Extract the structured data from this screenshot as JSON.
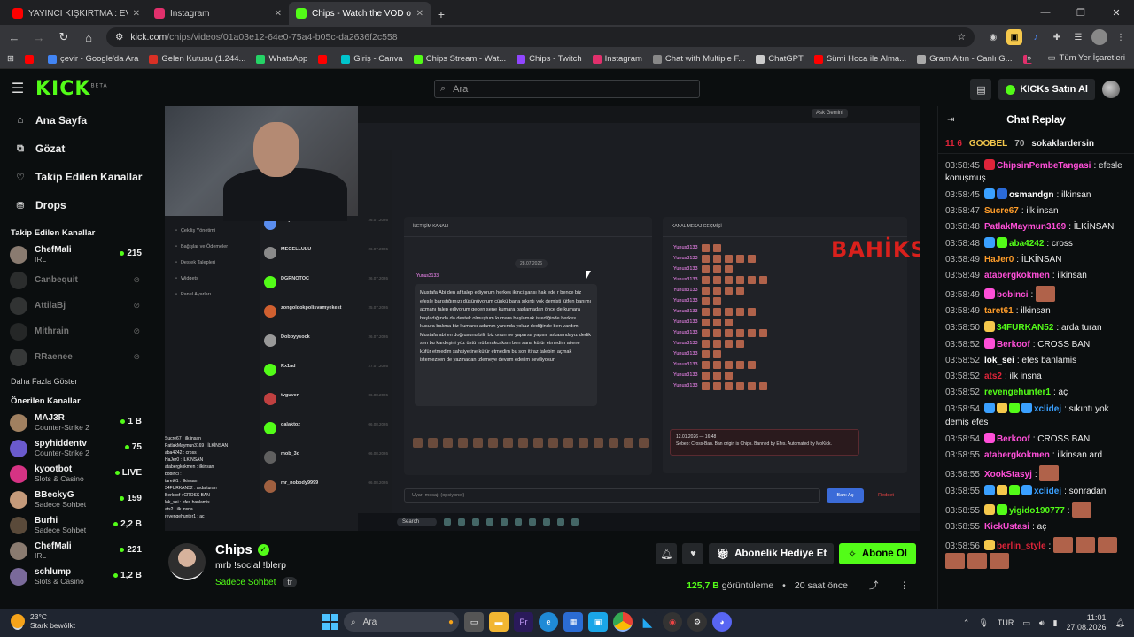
{
  "browser": {
    "tabs": [
      {
        "title": "YAYINCI KIŞKIRTMA : EVE DÖN",
        "color": "#ff0000"
      },
      {
        "title": "Instagram",
        "color": "#e1306c"
      },
      {
        "title": "Chips - Watch the VOD on",
        "color": "#53fc18"
      }
    ],
    "url_host": "kick.com",
    "url_path": "/chips/videos/01a03e12-64e0-75a4-b05c-da2636f2c558",
    "bookmarks": [
      {
        "label": "",
        "color": "#ff0000"
      },
      {
        "label": "çevir - Google'da Ara",
        "color": "#4285f4"
      },
      {
        "label": "Gelen Kutusu (1.244...",
        "color": "#d93025"
      },
      {
        "label": "WhatsApp",
        "color": "#25d366"
      },
      {
        "label": "",
        "color": "#ff0000"
      },
      {
        "label": "Giriş - Canva",
        "color": "#00c4cc"
      },
      {
        "label": "Chips Stream - Wat...",
        "color": "#53fc18"
      },
      {
        "label": "Chips - Twitch",
        "color": "#9146ff"
      },
      {
        "label": "Instagram",
        "color": "#e1306c"
      },
      {
        "label": "Chat with Multiple F...",
        "color": "#888888"
      },
      {
        "label": "ChatGPT",
        "color": "#cccccc"
      },
      {
        "label": "Sümi Hoca ile Alma...",
        "color": "#ff0000"
      },
      {
        "label": "Gram Altın - Canlı G...",
        "color": "#aaaaaa"
      },
      {
        "label": "almancanotlar",
        "color": "#e1306c"
      }
    ],
    "all_bookmarks": "Tüm Yer İşaretleri"
  },
  "header": {
    "logo": "KICK",
    "logo_beta": "BETA",
    "search_placeholder": "Ara",
    "buy_kicks": "KICKs Satın Al"
  },
  "sidebar": {
    "nav": [
      {
        "label": "Ana Sayfa",
        "icon": "home-icon",
        "glyph": "⌂"
      },
      {
        "label": "Gözat",
        "icon": "browse-icon",
        "glyph": "⧉"
      },
      {
        "label": "Takip Edilen Kanallar",
        "icon": "heart-icon",
        "glyph": "♡"
      },
      {
        "label": "Drops",
        "icon": "drops-icon",
        "glyph": "⛃"
      }
    ],
    "followed_title": "Takip Edilen Kanallar",
    "followed": [
      {
        "name": "ChefMali",
        "category": "IRL",
        "viewers": "215",
        "online": true,
        "color": "#8a7b70"
      },
      {
        "name": "Canbequit",
        "category": "",
        "viewers": "",
        "online": false,
        "color": "#666666"
      },
      {
        "name": "AttilaBj",
        "category": "",
        "viewers": "",
        "online": false,
        "color": "#777777"
      },
      {
        "name": "Mithrain",
        "category": "",
        "viewers": "",
        "online": false,
        "color": "#555555"
      },
      {
        "name": "RRaenee",
        "category": "",
        "viewers": "",
        "online": false,
        "color": "#888888"
      }
    ],
    "show_more": "Daha Fazla Göster",
    "recommended_title": "Önerilen Kanallar",
    "recommended": [
      {
        "name": "MAJ3R",
        "category": "Counter-Strike 2",
        "viewers": "1 B",
        "color": "#a08060"
      },
      {
        "name": "spyhiddentv",
        "category": "Counter-Strike 2",
        "viewers": "75",
        "color": "#6a5acd"
      },
      {
        "name": "kyootbot",
        "category": "Slots & Casino",
        "viewers": "LIVE",
        "color": "#d63384"
      },
      {
        "name": "BBeckyG",
        "category": "Sadece Sohbet",
        "viewers": "159",
        "color": "#c49a7a"
      },
      {
        "name": "Burhi",
        "category": "Sadece Sohbet",
        "viewers": "2,2 B",
        "color": "#5a4a3a"
      },
      {
        "name": "ChefMali",
        "category": "IRL",
        "viewers": "221",
        "color": "#8a7b70"
      },
      {
        "name": "schlump",
        "category": "Slots & Casino",
        "viewers": "1,2 B",
        "color": "#7a6a9a"
      }
    ]
  },
  "video": {
    "ask_gemini": "Ask Gemini",
    "left_panel": [
      "Çekiliş Yönetimi",
      "Bağışlar ve Ödemeler",
      "Destek Talepleri",
      "Widgets",
      "Panel Ayarları"
    ],
    "dm_users": [
      {
        "name": "erayusto",
        "date": "26.07.2026",
        "color": "#5a8dee"
      },
      {
        "name": "MEGELLULU",
        "date": "26.07.2026",
        "color": "#8a8a8a"
      },
      {
        "name": "DGRNOTOC",
        "date": "26.07.2026",
        "color": "#53fc18"
      },
      {
        "name": "zongoldokpolisvamyekest",
        "date": "25.07.2026",
        "color": "#d06030"
      },
      {
        "name": "Dobbyysock",
        "date": "26.07.2026",
        "color": "#999999"
      },
      {
        "name": "Rx1ad",
        "date": "27.07.2026",
        "color": "#53fc18"
      },
      {
        "name": "tvguven",
        "date": "06.08.2026",
        "color": "#c04040"
      },
      {
        "name": "galaktoz",
        "date": "06.08.2026",
        "color": "#53fc18"
      },
      {
        "name": "mob_3d",
        "date": "06.08.2026",
        "color": "#606060"
      },
      {
        "name": "mr_nobody9999",
        "date": "06.08.2026",
        "color": "#a06040"
      }
    ],
    "overlay_chat": [
      "Sucre67 : ilk insan",
      "PatlakMaymun3169 : İLKİNSAN",
      "aba4242 : cross",
      "HaJer0 : İLKİNSAN",
      "atabergkokmen : ilkinsan",
      "bobinci :",
      "taret61 : ilkinsan",
      "34FURKAN52 : arda turan",
      "Berkoof : CROSS BAN",
      "lok_sei : efes banlamis",
      "ats2 : ilk insna",
      "revengehunter1 : aç"
    ],
    "conversation_header": "İLETİŞİM KANALI",
    "conv_date": "28.07.2026",
    "dm_user": "Yunus3133",
    "message": "Mustafa Abi den af talep ediyorum herkes ikinci şansı hak ede r bence biz efesle barıştığımızı düşünüyorum çünkü bana sıkıntı yok demişti lütfen banımı açmanı talep ediyorum geçen sene kumara başlamadan önce de kumara başladığında da destek olmuştum kumara başlamak istediğinde herkes kusura bakma biz kumarcı adamın yanında yokuz dediğinde ben vardım Mustafa abi en doğrusunu bilir biz onun ne yaparsa yapsın arkasındayız dedik sen bu kardeşini yüz üstü mü bırakcaksın ben sana küfür etmedim ailene küfür etmedim şahsiyetine küfür etmedim bu son itiraz talebim açmak istemezsen de yazmadan izlemeye devam ederim seviliyosun",
    "history_header": "KANAL MESAJ GEÇMİŞİ",
    "history_user": "Yunus3133",
    "bahiks": "BAHİKS",
    "ban_text": "Sebep: Cross-Ban. Ban origin is Chips. Banned by Efes. Automated by MoKick.",
    "ban_date": "12.01.2026 — 16:48",
    "reason_placeholder": "Uyarı mesajı (opsiyonel)",
    "ban_button": "Banı Aç",
    "reject_button": "Reddet",
    "inner_search": "Search"
  },
  "stream": {
    "name": "Chips",
    "title": "mrb !social !blerp",
    "category": "Sadece Sohbet",
    "language": "tr",
    "gift_sub": "Abonelik Hediye Et",
    "subscribe": "Abone Ol",
    "views_value": "125,7 B",
    "views_label": "görüntüleme",
    "time_ago": "20 saat önce"
  },
  "chat": {
    "title": "Chat Replay",
    "pinned": [
      {
        "text": "11 6",
        "color": "#e0243a"
      },
      {
        "text": "GOOBEL",
        "color": "#f5c84c"
      },
      {
        "text": "70",
        "color": "#aaaaaa"
      },
      {
        "text": "sokaklardersin",
        "color": "#eeeeee"
      }
    ],
    "messages": [
      {
        "time": "03:58:45",
        "user": "ChipsinPembeTangasi",
        "color": "#ff4fd8",
        "badges": [
          "#e0243a"
        ],
        "text": "efesle konuşmuş",
        "emotes": 0
      },
      {
        "time": "03:58:45",
        "user": "osmandgn",
        "color": "#ffffff",
        "badges": [
          "#3aa0ff",
          "#2a6ad8"
        ],
        "text": "ilkinsan",
        "emotes": 0
      },
      {
        "time": "03:58:47",
        "user": "Sucre67",
        "color": "#ff9d2a",
        "badges": [],
        "text": "ilk insan",
        "emotes": 0
      },
      {
        "time": "03:58:48",
        "user": "PatlakMaymun3169",
        "color": "#ff4fd8",
        "badges": [],
        "text": "İLKİNSAN",
        "emotes": 0
      },
      {
        "time": "03:58:48",
        "user": "aba4242",
        "color": "#53fc18",
        "badges": [
          "#3aa0ff",
          "#53fc18"
        ],
        "text": "cross",
        "emotes": 0
      },
      {
        "time": "03:58:49",
        "user": "HaJer0",
        "color": "#ff9d2a",
        "badges": [],
        "text": "İLKİNSAN",
        "emotes": 0
      },
      {
        "time": "03:58:49",
        "user": "atabergkokmen",
        "color": "#ff4fd8",
        "badges": [],
        "text": "ilkinsan",
        "emotes": 0
      },
      {
        "time": "03:58:49",
        "user": "bobinci",
        "color": "#ff4fd8",
        "badges": [
          "#ff4fd8"
        ],
        "text": "",
        "emotes": 1
      },
      {
        "time": "03:58:49",
        "user": "taret61",
        "color": "#ff9d2a",
        "badges": [],
        "text": "ilkinsan",
        "emotes": 0
      },
      {
        "time": "03:58:50",
        "user": "34FURKAN52",
        "color": "#53fc18",
        "badges": [
          "#f5c84c"
        ],
        "text": "arda turan",
        "emotes": 0
      },
      {
        "time": "03:58:52",
        "user": "Berkoof",
        "color": "#ff4fd8",
        "badges": [
          "#ff4fd8"
        ],
        "text": "CROSS BAN",
        "emotes": 0
      },
      {
        "time": "03:58:52",
        "user": "lok_sei",
        "color": "#ffffff",
        "badges": [],
        "text": "efes banlamis",
        "emotes": 0
      },
      {
        "time": "03:58:52",
        "user": "ats2",
        "color": "#e0243a",
        "badges": [],
        "text": "ilk insna",
        "emotes": 0
      },
      {
        "time": "03:58:52",
        "user": "revengehunter1",
        "color": "#53fc18",
        "badges": [],
        "text": "aç",
        "emotes": 0
      },
      {
        "time": "03:58:54",
        "user": "xclidej",
        "color": "#3aa0ff",
        "badges": [
          "#3aa0ff",
          "#f5c84c",
          "#53fc18",
          "#3aa0ff"
        ],
        "text": "sıkıntı yok demiş efes",
        "emotes": 0
      },
      {
        "time": "03:58:54",
        "user": "Berkoof",
        "color": "#ff4fd8",
        "badges": [
          "#ff4fd8"
        ],
        "text": "CROSS BAN",
        "emotes": 0
      },
      {
        "time": "03:58:55",
        "user": "atabergkokmen",
        "color": "#ff4fd8",
        "badges": [],
        "text": "ilkinsan ard",
        "emotes": 0
      },
      {
        "time": "03:58:55",
        "user": "XookStasyj",
        "color": "#ff4fd8",
        "badges": [],
        "text": "",
        "emotes": 1
      },
      {
        "time": "03:58:55",
        "user": "xclidej",
        "color": "#3aa0ff",
        "badges": [
          "#3aa0ff",
          "#f5c84c",
          "#53fc18",
          "#3aa0ff"
        ],
        "text": "sonradan",
        "emotes": 0
      },
      {
        "time": "03:58:55",
        "user": "yigido190777",
        "color": "#53fc18",
        "badges": [
          "#f5c84c",
          "#53fc18"
        ],
        "text": "",
        "emotes": 1
      },
      {
        "time": "03:58:55",
        "user": "KickUstasi",
        "color": "#ff4fd8",
        "badges": [],
        "text": "aç",
        "emotes": 0
      },
      {
        "time": "03:58:56",
        "user": "berlin_style",
        "color": "#e0243a",
        "badges": [
          "#f5c84c"
        ],
        "text": "",
        "emotes": 6
      }
    ]
  },
  "taskbar": {
    "temp": "23°C",
    "weather": "Stark bewölkt",
    "search": "Ara",
    "lang": "TUR",
    "time": "11:01",
    "date": "27.08.2026"
  }
}
